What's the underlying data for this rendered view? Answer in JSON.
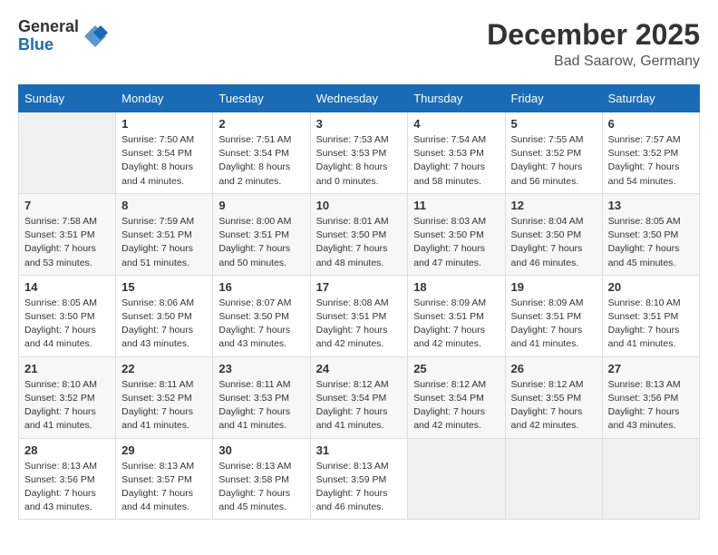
{
  "logo": {
    "general": "General",
    "blue": "Blue"
  },
  "title": "December 2025",
  "location": "Bad Saarow, Germany",
  "days_of_week": [
    "Sunday",
    "Monday",
    "Tuesday",
    "Wednesday",
    "Thursday",
    "Friday",
    "Saturday"
  ],
  "weeks": [
    [
      {
        "day": "",
        "info": ""
      },
      {
        "day": "1",
        "info": "Sunrise: 7:50 AM\nSunset: 3:54 PM\nDaylight: 8 hours\nand 4 minutes."
      },
      {
        "day": "2",
        "info": "Sunrise: 7:51 AM\nSunset: 3:54 PM\nDaylight: 8 hours\nand 2 minutes."
      },
      {
        "day": "3",
        "info": "Sunrise: 7:53 AM\nSunset: 3:53 PM\nDaylight: 8 hours\nand 0 minutes."
      },
      {
        "day": "4",
        "info": "Sunrise: 7:54 AM\nSunset: 3:53 PM\nDaylight: 7 hours\nand 58 minutes."
      },
      {
        "day": "5",
        "info": "Sunrise: 7:55 AM\nSunset: 3:52 PM\nDaylight: 7 hours\nand 56 minutes."
      },
      {
        "day": "6",
        "info": "Sunrise: 7:57 AM\nSunset: 3:52 PM\nDaylight: 7 hours\nand 54 minutes."
      }
    ],
    [
      {
        "day": "7",
        "info": "Sunrise: 7:58 AM\nSunset: 3:51 PM\nDaylight: 7 hours\nand 53 minutes."
      },
      {
        "day": "8",
        "info": "Sunrise: 7:59 AM\nSunset: 3:51 PM\nDaylight: 7 hours\nand 51 minutes."
      },
      {
        "day": "9",
        "info": "Sunrise: 8:00 AM\nSunset: 3:51 PM\nDaylight: 7 hours\nand 50 minutes."
      },
      {
        "day": "10",
        "info": "Sunrise: 8:01 AM\nSunset: 3:50 PM\nDaylight: 7 hours\nand 48 minutes."
      },
      {
        "day": "11",
        "info": "Sunrise: 8:03 AM\nSunset: 3:50 PM\nDaylight: 7 hours\nand 47 minutes."
      },
      {
        "day": "12",
        "info": "Sunrise: 8:04 AM\nSunset: 3:50 PM\nDaylight: 7 hours\nand 46 minutes."
      },
      {
        "day": "13",
        "info": "Sunrise: 8:05 AM\nSunset: 3:50 PM\nDaylight: 7 hours\nand 45 minutes."
      }
    ],
    [
      {
        "day": "14",
        "info": "Sunrise: 8:05 AM\nSunset: 3:50 PM\nDaylight: 7 hours\nand 44 minutes."
      },
      {
        "day": "15",
        "info": "Sunrise: 8:06 AM\nSunset: 3:50 PM\nDaylight: 7 hours\nand 43 minutes."
      },
      {
        "day": "16",
        "info": "Sunrise: 8:07 AM\nSunset: 3:50 PM\nDaylight: 7 hours\nand 43 minutes."
      },
      {
        "day": "17",
        "info": "Sunrise: 8:08 AM\nSunset: 3:51 PM\nDaylight: 7 hours\nand 42 minutes."
      },
      {
        "day": "18",
        "info": "Sunrise: 8:09 AM\nSunset: 3:51 PM\nDaylight: 7 hours\nand 42 minutes."
      },
      {
        "day": "19",
        "info": "Sunrise: 8:09 AM\nSunset: 3:51 PM\nDaylight: 7 hours\nand 41 minutes."
      },
      {
        "day": "20",
        "info": "Sunrise: 8:10 AM\nSunset: 3:51 PM\nDaylight: 7 hours\nand 41 minutes."
      }
    ],
    [
      {
        "day": "21",
        "info": "Sunrise: 8:10 AM\nSunset: 3:52 PM\nDaylight: 7 hours\nand 41 minutes."
      },
      {
        "day": "22",
        "info": "Sunrise: 8:11 AM\nSunset: 3:52 PM\nDaylight: 7 hours\nand 41 minutes."
      },
      {
        "day": "23",
        "info": "Sunrise: 8:11 AM\nSunset: 3:53 PM\nDaylight: 7 hours\nand 41 minutes."
      },
      {
        "day": "24",
        "info": "Sunrise: 8:12 AM\nSunset: 3:54 PM\nDaylight: 7 hours\nand 41 minutes."
      },
      {
        "day": "25",
        "info": "Sunrise: 8:12 AM\nSunset: 3:54 PM\nDaylight: 7 hours\nand 42 minutes."
      },
      {
        "day": "26",
        "info": "Sunrise: 8:12 AM\nSunset: 3:55 PM\nDaylight: 7 hours\nand 42 minutes."
      },
      {
        "day": "27",
        "info": "Sunrise: 8:13 AM\nSunset: 3:56 PM\nDaylight: 7 hours\nand 43 minutes."
      }
    ],
    [
      {
        "day": "28",
        "info": "Sunrise: 8:13 AM\nSunset: 3:56 PM\nDaylight: 7 hours\nand 43 minutes."
      },
      {
        "day": "29",
        "info": "Sunrise: 8:13 AM\nSunset: 3:57 PM\nDaylight: 7 hours\nand 44 minutes."
      },
      {
        "day": "30",
        "info": "Sunrise: 8:13 AM\nSunset: 3:58 PM\nDaylight: 7 hours\nand 45 minutes."
      },
      {
        "day": "31",
        "info": "Sunrise: 8:13 AM\nSunset: 3:59 PM\nDaylight: 7 hours\nand 46 minutes."
      },
      {
        "day": "",
        "info": ""
      },
      {
        "day": "",
        "info": ""
      },
      {
        "day": "",
        "info": ""
      }
    ]
  ]
}
